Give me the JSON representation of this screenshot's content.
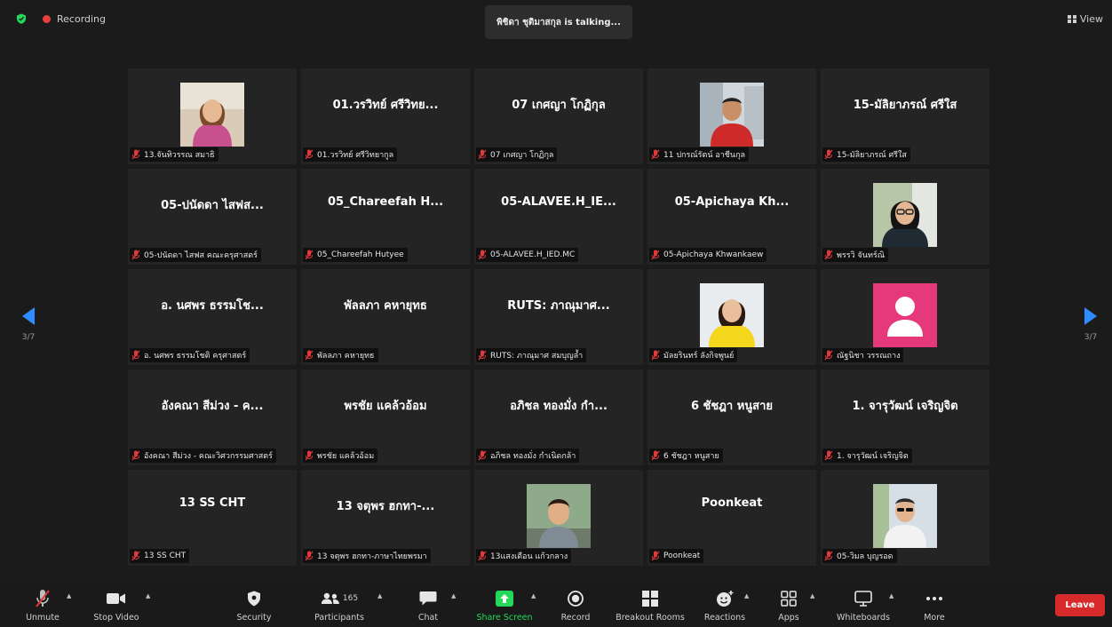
{
  "topbar": {
    "recording_label": "Recording",
    "talking_text": "พิชิดา ชุติมาสกุล is talking...",
    "view_label": "View"
  },
  "tiles": [
    {
      "name": "",
      "label": "13.จันทิวรรณ สมาธิ",
      "photo": "woman-pink"
    },
    {
      "name": "01.วรวิทย์ ศรีวิทย...",
      "label": "01.วรวิทย์ ศรีวิทยากูล",
      "photo": ""
    },
    {
      "name": "07 เกศญา โกฏิกุล",
      "label": "07 เกศญา โกฏิกุล",
      "photo": ""
    },
    {
      "name": "",
      "label": "11 ปกรณ์รัตน์ อาชีนกุล",
      "photo": "man-red"
    },
    {
      "name": "15-มัลิยาภรณ์ ศรีใส",
      "label": "15-มัลิยาภรณ์ ศรีใส",
      "photo": ""
    },
    {
      "name": "05-ปนัดดา ไสฟส...",
      "label": "05-ปนัดดา ไสฟส คณะครุศาสตร์",
      "photo": ""
    },
    {
      "name": "05_Chareefah H...",
      "label": "05_Chareefah Hutyee",
      "photo": ""
    },
    {
      "name": "05-ALAVEE.H_IE...",
      "label": "05-ALAVEE.H_IED.MC",
      "photo": ""
    },
    {
      "name": "05-Apichaya Kh...",
      "label": "05-Apichaya Khwankaew",
      "photo": ""
    },
    {
      "name": "",
      "label": "พรรวิ จันทร์ณิ",
      "photo": "woman-glasses"
    },
    {
      "name": "อ. นศพร ธรรมโช...",
      "label": "อ. นศพร ธรรมโชติ ครุศาสตร์",
      "photo": ""
    },
    {
      "name": "พัลลภา คหายุทธ",
      "label": "พัลลภา คหายุทธ",
      "photo": ""
    },
    {
      "name": "RUTS: ภาณุมาศ...",
      "label": "RUTS: ภาณุมาศ สมบุญล้ำ",
      "photo": ""
    },
    {
      "name": "",
      "label": "มัลยรินทร์ ลังกิจพูนย์",
      "photo": "woman-yellow"
    },
    {
      "name": "",
      "label": "ณัฐนิชา วรรณถาง",
      "photo": "avatar-pink"
    },
    {
      "name": "อังคณา สีม่วง - ค...",
      "label": "อังคณา สีม่วง - คณะวิศวกรรมศาสตร์",
      "photo": ""
    },
    {
      "name": "พรชัย แคล้วอ้อม",
      "label": "พรชัย แคล้วอ้อม",
      "photo": ""
    },
    {
      "name": "อภิชล ทองมั่ง กำ...",
      "label": "อภิชล ทองมั่ง กำเนิดกล้า",
      "photo": ""
    },
    {
      "name": "6 ชัชฎา หนูสาย",
      "label": "6 ชัชฎา หนูสาย",
      "photo": ""
    },
    {
      "name": "1. จารุวัฒน์ เจริญจิต",
      "label": "1. จารุวัฒน์ เจริญจิต",
      "photo": ""
    },
    {
      "name": "13 SS CHT",
      "label": "13 SS CHT",
      "photo": ""
    },
    {
      "name": "13 จตุพร ฮกทา-...",
      "label": "13 จตุพร ฮกทา-ภาษาไทยพรมา",
      "photo": ""
    },
    {
      "name": "",
      "label": "13แสงเดือน แก้วกลาง",
      "photo": "child"
    },
    {
      "name": "Poonkeat",
      "label": "Poonkeat",
      "photo": ""
    },
    {
      "name": "",
      "label": "05-วิมล บุญรอด",
      "photo": "man-sunglasses"
    }
  ],
  "pager": {
    "left": "3/7",
    "right": "3/7"
  },
  "toolbar": {
    "unmute": "Unmute",
    "stop_video": "Stop Video",
    "security": "Security",
    "participants": "Participants",
    "participant_count": "165",
    "chat": "Chat",
    "share_screen": "Share Screen",
    "record": "Record",
    "breakout_rooms": "Breakout Rooms",
    "reactions": "Reactions",
    "apps": "Apps",
    "whiteboards": "Whiteboards",
    "more": "More",
    "leave": "Leave"
  },
  "colors": {
    "share_green": "#23d959",
    "leave_red": "#d72b2b",
    "muted_red": "#e0393b",
    "pager_blue": "#2d8cff"
  }
}
